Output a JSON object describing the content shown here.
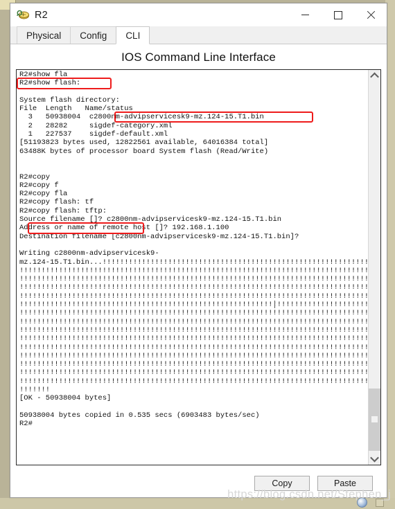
{
  "window": {
    "title": "R2",
    "icon": "router-icon",
    "controls": {
      "minimize": "minimize-icon",
      "maximize": "maximize-icon",
      "close": "close-icon"
    }
  },
  "tabs": [
    {
      "label": "Physical",
      "active": false
    },
    {
      "label": "Config",
      "active": false
    },
    {
      "label": "CLI",
      "active": true
    }
  ],
  "heading": "IOS Command Line Interface",
  "terminal": {
    "lines": [
      "R2#show fla",
      "R2#show flash:",
      "",
      "System flash directory:",
      "File  Length   Name/status",
      "  3   50938004  c2800nm-advipservicesk9-mz.124-15.T1.bin",
      "  2   28282     sigdef-category.xml",
      "  1   227537    sigdef-default.xml",
      "[51193823 bytes used, 12822561 available, 64016384 total]",
      "63488K bytes of processor board System flash (Read/Write)",
      "",
      "",
      "R2#copy",
      "R2#copy f",
      "R2#copy fla",
      "R2#copy flash: tf",
      "R2#copy flash: tftp:",
      "Source filename []? c2800nm-advipservicesk9-mz.124-15.T1.bin",
      "Address or name of remote host []? 192.168.1.100",
      "Destination filename [c2800nm-advipservicesk9-mz.124-15.T1.bin]?",
      "",
      "Writing c2800nm-advipservicesk9-",
      "mz.124-15.T1.bin...!!!!!!!!!!!!!!!!!!!!!!!!!!!!!!!!!!!!!!!!!!!!!!!!!!!!!!!!!!!!!!",
      "!!!!!!!!!!!!!!!!!!!!!!!!!!!!!!!!!!!!!!!!!!!!!!!!!!!!!!!!!!!!!!!!!!!!!!!!!!!!!!!!!!!!",
      "!!!!!!!!!!!!!!!!!!!!!!!!!!!!!!!!!!!!!!!!!!!!!!!!!!!!!!!!!!!!!!!!!!!!!!!!!!!!!!!!!!!!",
      "!!!!!!!!!!!!!!!!!!!!!!!!!!!!!!!!!!!!!!!!!!!!!!!!!!!!!!!!!!!!!!!!!!!!!!!!!!!!!!!!!!!!",
      "!!!!!!!!!!!!!!!!!!!!!!!!!!!!!!!!!!!!!!!!!!!!!!!!!!!!!!!!!!!!!!!!!!!!!!!!!!!!!!!!!!!!",
      "!!!!!!!!!!!!!!!!!!!!!!!!!!!!!!!!!!!!!!!!!!!!!!!!!!!!!!!!!!!!!!!!!!!!!!!!!!!!!!!!!!!!",
      "!!!!!!!!!!!!!!!!!!!!!!!!!!!!!!!!!!!!!!!!!!!!!!!!!!!!!!!!!!!!!!!!!!!!!!!!!!!!!!!!!!!!",
      "!!!!!!!!!!!!!!!!!!!!!!!!!!!!!!!!!!!!!!!!!!!!!!!!!!!!!!!!!!!!!!!!!!!!!!!!!!!!!!!!!!!!",
      "!!!!!!!!!!!!!!!!!!!!!!!!!!!!!!!!!!!!!!!!!!!!!!!!!!!!!!!!!!!!!!!!!!!!!!!!!!!!!!!!!!!!",
      "!!!!!!!!!!!!!!!!!!!!!!!!!!!!!!!!!!!!!!!!!!!!!!!!!!!!!!!!!!!!!!!!!!!!!!!!!!!!!!!!!!!!",
      "!!!!!!!!!!!!!!!!!!!!!!!!!!!!!!!!!!!!!!!!!!!!!!!!!!!!!!!!!!!!!!!!!!!!!!!!!!!!!!!!!!!!",
      "!!!!!!!!!!!!!!!!!!!!!!!!!!!!!!!!!!!!!!!!!!!!!!!!!!!!!!!!!!!!!!!!!!!!!!!!!!!!!!!!!!!!",
      "!!!!!!!!!!!!!!!!!!!!!!!!!!!!!!!!!!!!!!!!!!!!!!!!!!!!!!!!!!!!!!!!!!!!!!!!!!!!!!!!!!!!",
      "!!!!!!!!!!!!!!!!!!!!!!!!!!!!!!!!!!!!!!!!!!!!!!!!!!!!!!!!!!!!!!!!!!!!!!!!!!!!!!!!!!!!",
      "!!!!!!!!!!!!!!!!!!!!!!!!!!!!!!!!!!!!!!!!!!!!!!!!!!!!!!!!!!!!!!!!!!!!!!!!!!!!!!!!!!!!",
      "!!!!!!!",
      "[OK - 50938004 bytes]",
      "",
      "50938004 bytes copied in 0.535 secs (6903483 bytes/sec)",
      "R2#"
    ]
  },
  "annotations": {
    "accent_color": "#ee1b1b",
    "boxes": [
      {
        "name": "show-flash-command",
        "text": "R2#show flash:"
      },
      {
        "name": "ios-image-filename",
        "text": "c2800nm-advipservicesk9-mz.124-15.T1.bin"
      },
      {
        "name": "copy-flash-tftp-command",
        "text": "copy flash: tftp:"
      }
    ]
  },
  "scrollbar": {
    "up_icon": "chevron-up-icon",
    "down_icon": "chevron-down-icon"
  },
  "buttons": {
    "copy": "Copy",
    "paste": "Paste"
  },
  "watermark": "https://blog.csdn.net/Stephen_j"
}
